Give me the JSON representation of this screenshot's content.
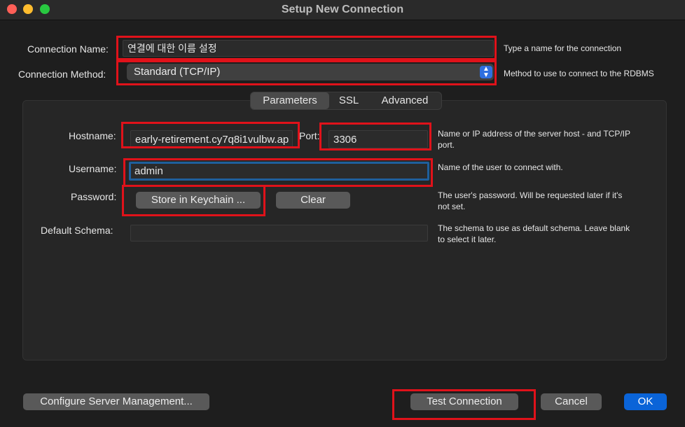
{
  "window": {
    "title": "Setup New Connection"
  },
  "connection": {
    "name_label": "Connection Name:",
    "name_value": "연결에 대한 이름 설정",
    "name_hint": "Type a name for the connection",
    "method_label": "Connection Method:",
    "method_value": "Standard (TCP/IP)",
    "method_hint": "Method to use to connect to the RDBMS"
  },
  "tabs": [
    {
      "label": "Parameters",
      "active": true
    },
    {
      "label": "SSL",
      "active": false
    },
    {
      "label": "Advanced",
      "active": false
    }
  ],
  "parameters": {
    "hostname_label": "Hostname:",
    "hostname_value": "early-retirement.cy7q8i1vulbw.ap",
    "port_label": "Port:",
    "port_value": "3306",
    "hostname_hint_line1": "Name or IP address of the server host - and TCP/IP",
    "hostname_hint_line2": "port.",
    "username_label": "Username:",
    "username_value": "admin",
    "username_hint": "Name of the user to connect with.",
    "password_label": "Password:",
    "store_keychain_label": "Store in Keychain ...",
    "clear_label": "Clear",
    "password_hint_line1": "The user's password. Will be requested later if it's",
    "password_hint_line2": "not set.",
    "schema_label": "Default Schema:",
    "schema_value": "",
    "schema_hint_line1": "The schema to use as default schema. Leave blank",
    "schema_hint_line2": "to select it later."
  },
  "footer": {
    "configure_label": "Configure Server Management...",
    "test_label": "Test Connection",
    "cancel_label": "Cancel",
    "ok_label": "OK"
  },
  "colors": {
    "highlight_box": "#e0121a",
    "accent_blue": "#0a64d8"
  }
}
